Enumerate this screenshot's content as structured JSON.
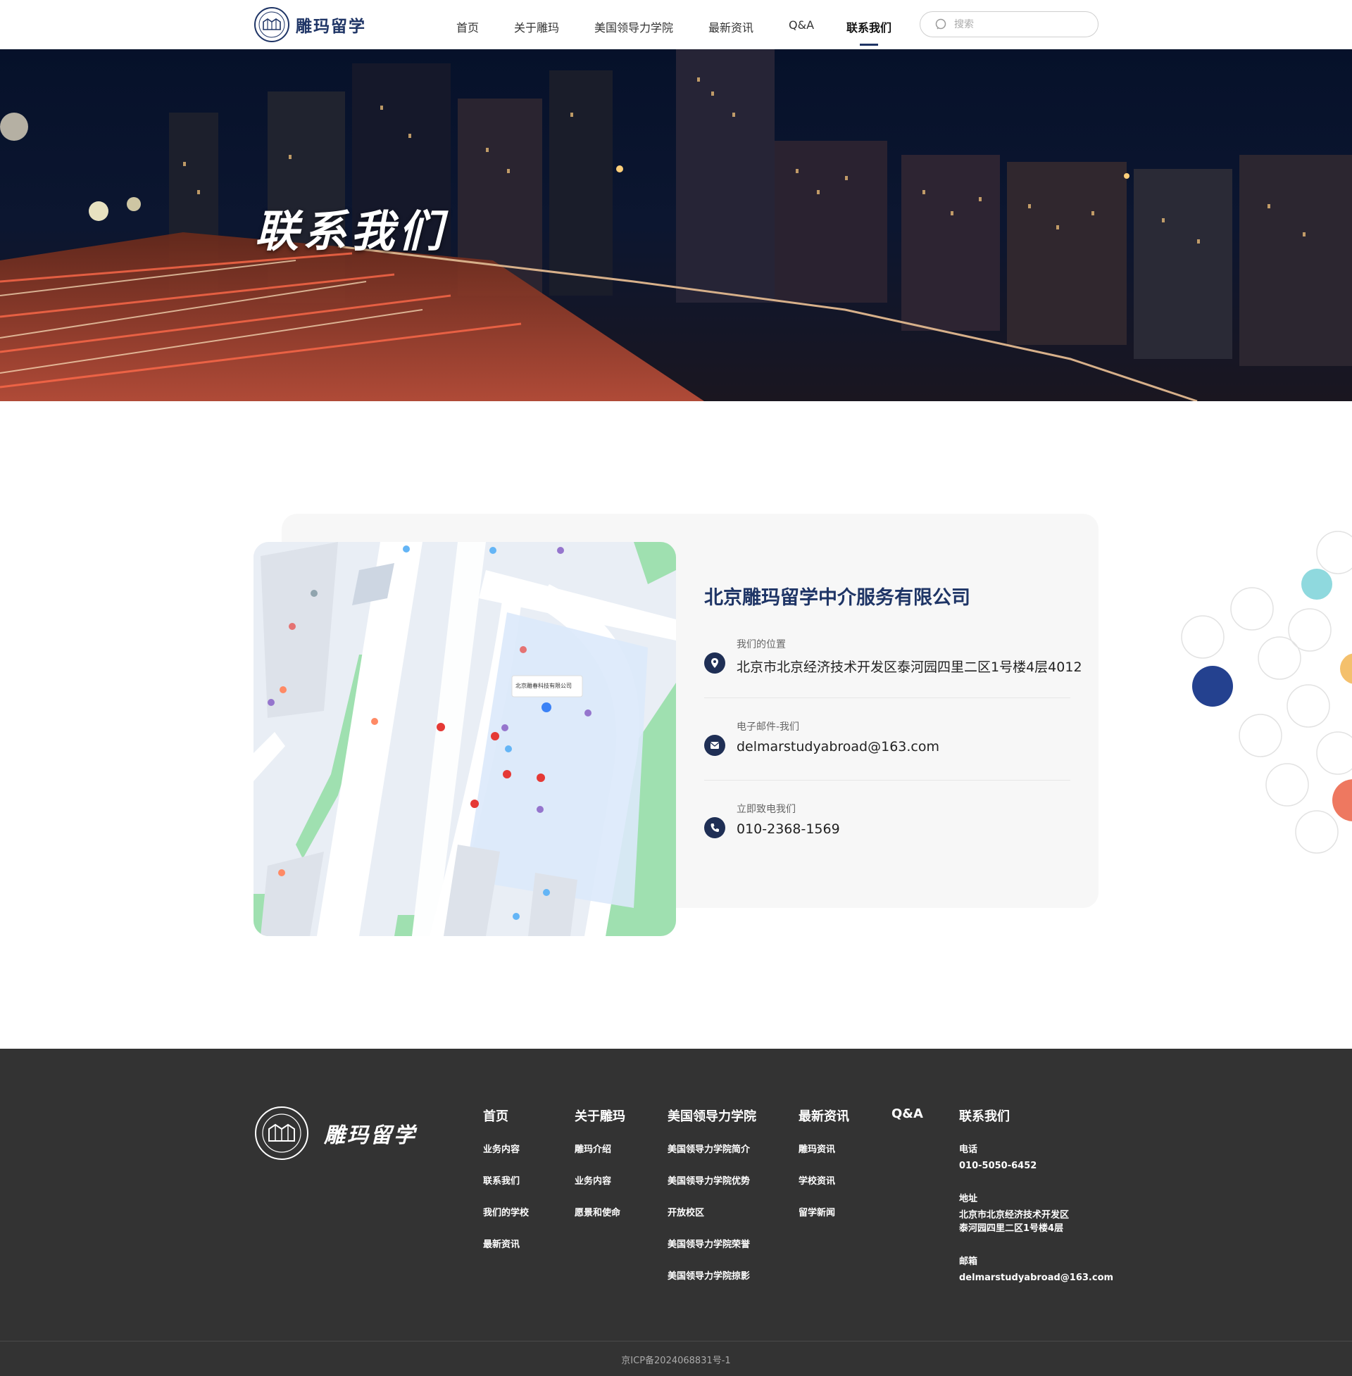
{
  "header": {
    "logo_text": "雕玛留学",
    "nav": [
      {
        "label": "首页",
        "active": false
      },
      {
        "label": "关于雕玛",
        "active": false
      },
      {
        "label": "美国领导力学院",
        "active": false
      },
      {
        "label": "最新资讯",
        "active": false
      },
      {
        "label": "Q&A",
        "active": false
      },
      {
        "label": "联系我们",
        "active": true
      }
    ],
    "search_placeholder": "搜索"
  },
  "hero": {
    "title": "联系我们"
  },
  "contact": {
    "company": "北京雕玛留学中介服务有限公司",
    "location_label": "我们的位置",
    "location_value": "北京市北京经济技术开发区泰河园四里二区1号楼4层4012",
    "email_label": "电子邮件-我们",
    "email_value": "delmarstudyabroad@163.com",
    "phone_label": "立即致电我们",
    "phone_value": "010-2368-1569",
    "map_label": "北京雕春科技有限公司"
  },
  "colors": {
    "brand": "#1f3566",
    "footer_bg": "#333333",
    "card_bg": "#f7f7f7"
  },
  "footer": {
    "logo_text": "雕玛留学",
    "columns": [
      {
        "title": "首页",
        "links": [
          "业务内容",
          "联系我们",
          "我们的学校",
          "最新资讯"
        ]
      },
      {
        "title": "关于雕玛",
        "links": [
          "雕玛介绍",
          "业务内容",
          "愿景和使命"
        ]
      },
      {
        "title": "美国领导力学院",
        "links": [
          "美国领导力学院简介",
          "美国领导力学院优势",
          "开放校区",
          "美国领导力学院荣誉",
          "美国领导力学院掠影"
        ]
      },
      {
        "title": "最新资讯",
        "links": [
          "雕玛资讯",
          "学校资讯",
          "留学新闻"
        ]
      },
      {
        "title": "Q&A",
        "links": []
      }
    ],
    "contact": {
      "title": "联系我们",
      "phone_label": "电话",
      "phone_value": "010-5050-6452",
      "address_label": "地址",
      "address_line1": "北京市北京经济技术开发区",
      "address_line2": "泰河园四里二区1号楼4层",
      "email_label": "邮箱",
      "email_value": "delmarstudyabroad@163.com"
    },
    "icp": "京ICP备2024068831号-1"
  }
}
